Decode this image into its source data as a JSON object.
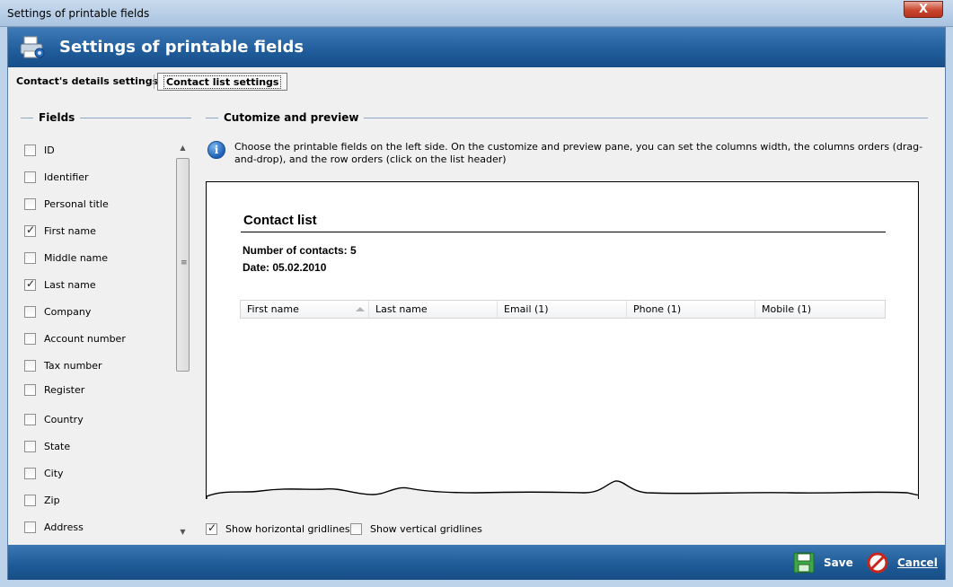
{
  "window": {
    "title": "Settings of printable fields",
    "close_glyph": "X"
  },
  "header": {
    "title": "Settings of printable fields",
    "icon": "printer-settings-icon"
  },
  "tabs": [
    {
      "label": "Contact's details settings",
      "active": false
    },
    {
      "label": "Contact list settings",
      "active": true
    }
  ],
  "fields_panel": {
    "title": "Fields",
    "items": [
      {
        "label": "ID",
        "checked": false
      },
      {
        "label": "Identifier",
        "checked": false
      },
      {
        "label": "Personal title",
        "checked": false
      },
      {
        "label": "First name",
        "checked": true
      },
      {
        "label": "Middle name",
        "checked": false
      },
      {
        "label": "Last name",
        "checked": true
      },
      {
        "label": "Company",
        "checked": false
      },
      {
        "label": "Account number",
        "checked": false
      },
      {
        "label": "Tax number",
        "checked": false
      },
      {
        "label": "Register",
        "checked": false
      },
      {
        "label": "Country",
        "checked": false
      },
      {
        "label": "State",
        "checked": false
      },
      {
        "label": "City",
        "checked": false
      },
      {
        "label": "Zip",
        "checked": false
      },
      {
        "label": "Address",
        "checked": false
      }
    ]
  },
  "preview_panel": {
    "title": "Cutomize and preview",
    "info_text": "Choose the printable fields on the left side. On the customize and preview pane, you can set the columns width, the columns orders (drag-and-drop), and the row orders (click on the list header)",
    "sheet": {
      "title": "Contact list",
      "count_line": "Number of contacts: 5",
      "date_line": "Date: 05.02.2010",
      "columns": [
        "First name",
        "Last name",
        "Email (1)",
        "Phone (1)",
        "Mobile (1)"
      ],
      "sorted_column": "First name"
    },
    "show_horizontal_gridlines": {
      "label": "Show horizontal gridlines",
      "checked": true
    },
    "show_vertical_gridlines": {
      "label": "Show vertical gridlines",
      "checked": false
    }
  },
  "footer": {
    "save_label": "Save",
    "cancel_label": "Cancel"
  },
  "colors": {
    "header_blue": "#1f5c99",
    "panel_bg": "#f0f0f0"
  }
}
